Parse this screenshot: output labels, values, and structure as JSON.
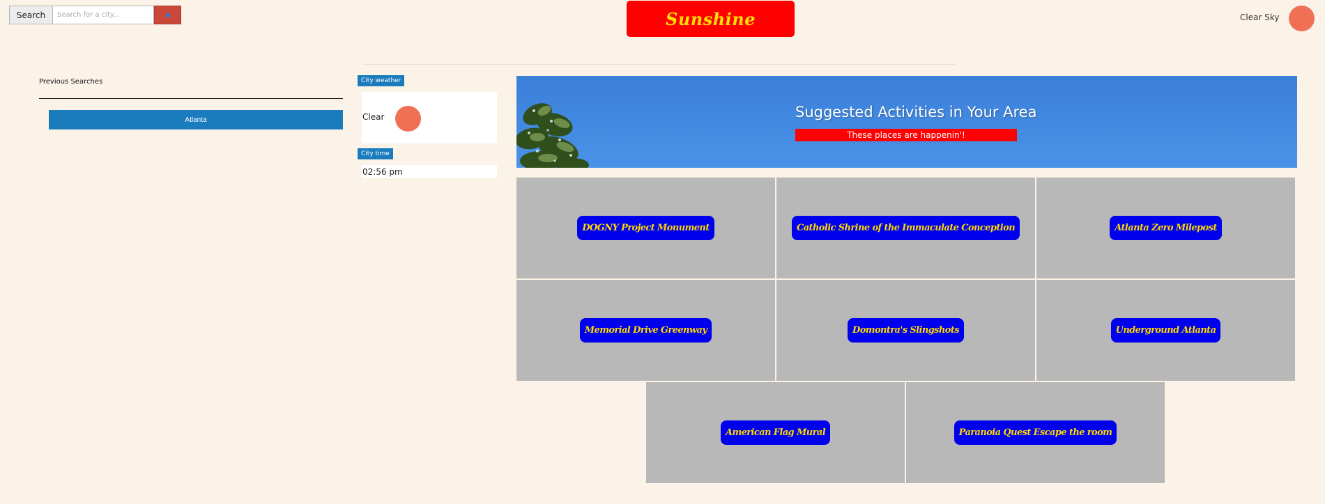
{
  "header": {
    "search_label": "Search",
    "search_placeholder": "Search for a city...",
    "logo_text": "Sunshine",
    "status_text": "Clear Sky"
  },
  "sidebar": {
    "title": "Previous Searches",
    "items": [
      {
        "label": "Atlanta"
      }
    ]
  },
  "city_weather": {
    "tag": "City weather",
    "condition": "Clear"
  },
  "city_time": {
    "tag": "City time",
    "value": "02:56 pm"
  },
  "activities": {
    "title": "Suggested Activities in Your Area",
    "subtitle": "These places are happenin'!",
    "items": [
      {
        "label": "DOGNY Project Monument"
      },
      {
        "label": "Catholic Shrine of the Immaculate Conception"
      },
      {
        "label": "Atlanta Zero Milepost"
      },
      {
        "label": "Memorial Drive Greenway"
      },
      {
        "label": "Domontra's Slingshots"
      },
      {
        "label": "Underground Atlanta"
      },
      {
        "label": "American Flag Mural"
      },
      {
        "label": "Paranoia Quest Escape the room"
      }
    ]
  },
  "colors": {
    "background": "#fcf3e8",
    "logo_bg": "#ff0000",
    "logo_text": "#ffe000",
    "accent_blue": "#1a7bbd",
    "weather_icon": "#ef7055",
    "tile_bg": "#b8b8b8",
    "tile_button": "#0000ee",
    "tile_button_text": "#ffd800"
  },
  "icons": {
    "search_button": "search-icon",
    "weather": "sun-icon"
  }
}
